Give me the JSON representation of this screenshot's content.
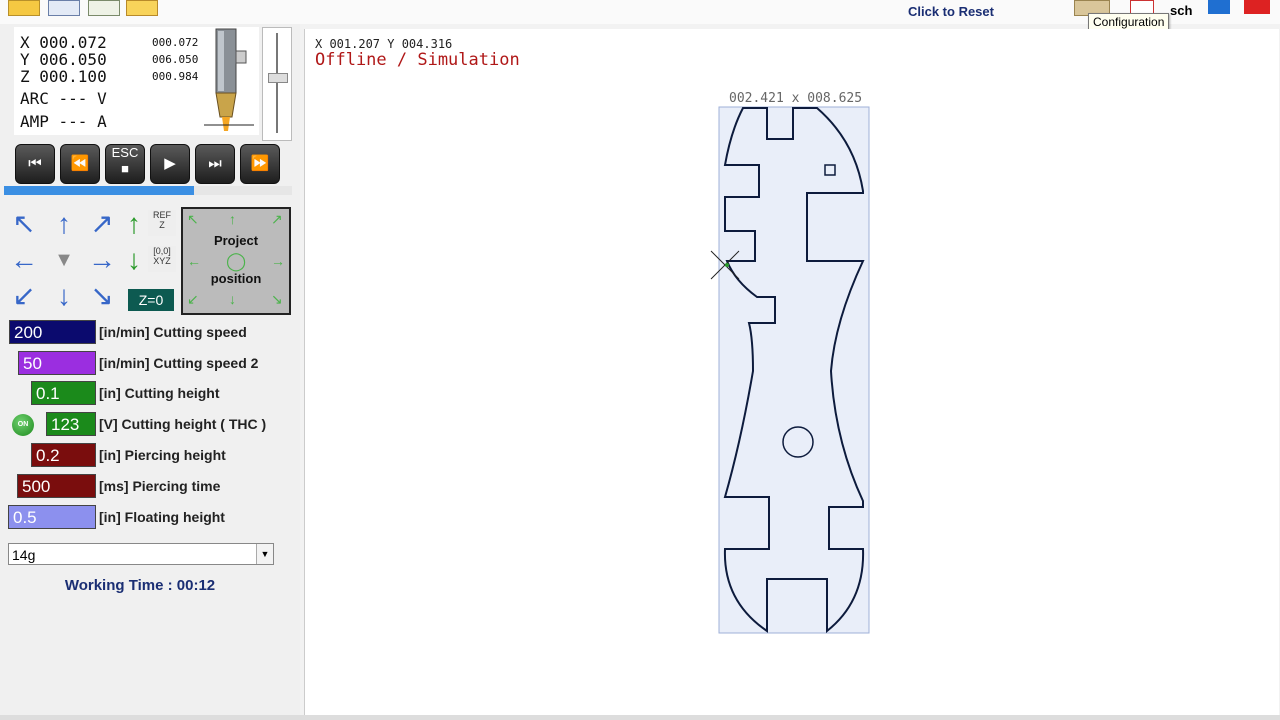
{
  "toolbar": {
    "reset_label": "Click to Reset",
    "tooltip": "Configuration",
    "partial_label": "sch"
  },
  "dro": {
    "x_label": "X 000.072",
    "y_label": "Y 006.050",
    "z_label": "Z 000.100",
    "x_small": "000.072",
    "y_small": "006.050",
    "z_small": "000.984",
    "arc_label": "ARC --- V",
    "amp_label": "AMP --- A"
  },
  "transport": {
    "esc_label": "ESC"
  },
  "progress": {
    "value": 0.66
  },
  "jog": {
    "ref_z_label": "REF\nZ",
    "xyz_label": "[0,0]\nXYZ",
    "z0_label": "Z=0",
    "project_label_1": "Project",
    "project_label_2": "position"
  },
  "params": [
    {
      "value": "200",
      "label": "[in/min] Cutting speed",
      "color": "#0b0a6e"
    },
    {
      "value": "50",
      "label": "[in/min] Cutting speed 2",
      "color": "#9b2ee0"
    },
    {
      "value": "0.1",
      "label": "[in] Cutting height",
      "color": "#1b8a1b"
    },
    {
      "value": "123",
      "label": "[V] Cutting height ( THC )",
      "color": "#1b8a1b"
    },
    {
      "value": "0.2",
      "label": "[in] Piercing height",
      "color": "#7a0d0d"
    },
    {
      "value": "500",
      "label": "[ms] Piercing time",
      "color": "#7a0d0d"
    },
    {
      "value": "0.5",
      "label": "[in] Floating height",
      "color": "#8c90ee"
    }
  ],
  "thc_toggle": "ON",
  "material_select": "14g",
  "working_time": "Working Time : 00:12",
  "canvas": {
    "coords": "X 001.207  Y 004.316",
    "status": "Offline / Simulation",
    "dimensions": "002.421 x  008.625"
  },
  "colors": {
    "accent": "#1a2e73",
    "status_red": "#b01818",
    "part_bg": "#e9eef9"
  }
}
